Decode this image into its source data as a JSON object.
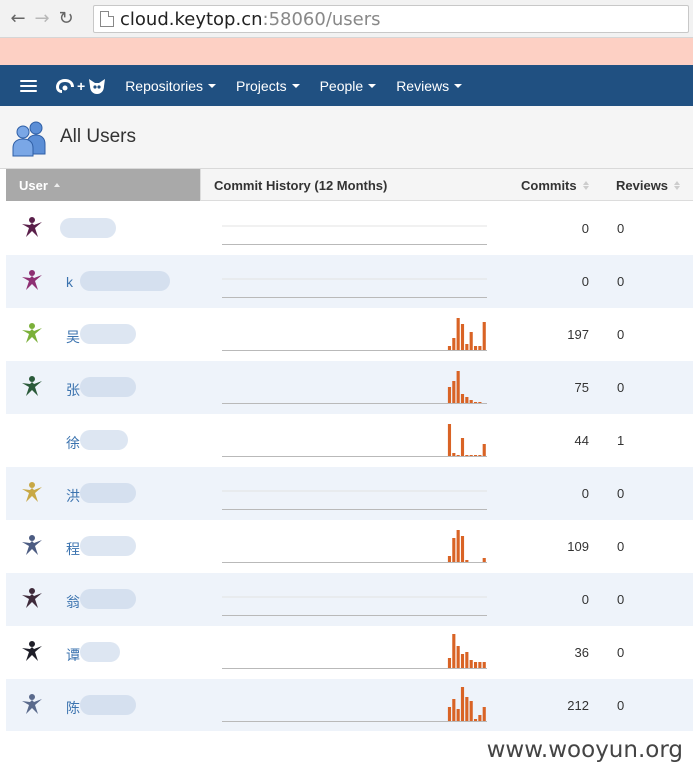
{
  "browser": {
    "back_icon": "←",
    "forward_icon": "→",
    "reload_icon": "↻",
    "url_host": "cloud.keytop.cn",
    "url_rest": ":58060/users"
  },
  "nav": {
    "menu": [
      {
        "label": "Repositories"
      },
      {
        "label": "Projects"
      },
      {
        "label": "People"
      },
      {
        "label": "Reviews"
      }
    ]
  },
  "header": {
    "title": "All Users"
  },
  "table": {
    "columns": {
      "user": "User",
      "history": "Commit History (12 Months)",
      "commits": "Commits",
      "reviews": "Reviews"
    },
    "rows": [
      {
        "name": "",
        "commits": "0",
        "reviews": "0",
        "avatar_color": "#5a1f4a",
        "history": [
          0,
          0,
          0,
          0,
          0,
          0,
          0,
          0,
          0,
          0,
          0,
          0
        ]
      },
      {
        "name": "k",
        "commits": "0",
        "reviews": "0",
        "avatar_color": "#8e2f73",
        "history": [
          0,
          0,
          0,
          0,
          0,
          0,
          0,
          0,
          0,
          0,
          0,
          0
        ]
      },
      {
        "name": "吴",
        "commits": "197",
        "reviews": "0",
        "avatar_color": "#7bb03a",
        "history": [
          0,
          0,
          0,
          0,
          0,
          0,
          0,
          0,
          0,
          0,
          0,
          0,
          0,
          0,
          0,
          0,
          0,
          0,
          0,
          0,
          0,
          0,
          0,
          0,
          0,
          0,
          0,
          0,
          0,
          0,
          0,
          0,
          0,
          0,
          0,
          0,
          0,
          0,
          0,
          0,
          0,
          0,
          0,
          0,
          0,
          0,
          0,
          0,
          0,
          0,
          0,
          0,
          4,
          12,
          32,
          26,
          6,
          18,
          4,
          4,
          28
        ]
      },
      {
        "name": "张",
        "commits": "75",
        "reviews": "0",
        "avatar_color": "#2b5a3a",
        "history": [
          0,
          0,
          0,
          0,
          0,
          0,
          0,
          0,
          0,
          0,
          0,
          0,
          0,
          0,
          0,
          0,
          0,
          0,
          0,
          0,
          0,
          0,
          0,
          0,
          0,
          0,
          0,
          0,
          0,
          0,
          0,
          0,
          0,
          0,
          0,
          0,
          0,
          0,
          0,
          0,
          0,
          0,
          0,
          0,
          0,
          0,
          0,
          0,
          0,
          0,
          0,
          0,
          16,
          22,
          32,
          9,
          6,
          3,
          1,
          1,
          0
        ]
      },
      {
        "name": "徐",
        "commits": "44",
        "reviews": "1",
        "avatar_color": "#ffffff",
        "history": [
          0,
          0,
          0,
          0,
          0,
          0,
          0,
          0,
          0,
          0,
          0,
          0,
          0,
          0,
          0,
          0,
          0,
          0,
          0,
          0,
          0,
          0,
          0,
          0,
          0,
          0,
          0,
          0,
          0,
          0,
          0,
          0,
          0,
          0,
          0,
          0,
          0,
          0,
          0,
          0,
          0,
          0,
          0,
          0,
          0,
          0,
          0,
          0,
          0,
          0,
          0,
          0,
          32,
          3,
          1,
          18,
          1,
          1,
          1,
          1,
          12
        ]
      },
      {
        "name": "洪",
        "commits": "0",
        "reviews": "0",
        "avatar_color": "#c8a845",
        "history": [
          0,
          0,
          0,
          0,
          0,
          0,
          0,
          0,
          0,
          0,
          0,
          0
        ]
      },
      {
        "name": "程",
        "commits": "109",
        "reviews": "0",
        "avatar_color": "#4c5c82",
        "history": [
          0,
          0,
          0,
          0,
          0,
          0,
          0,
          0,
          0,
          0,
          0,
          0,
          0,
          0,
          0,
          0,
          0,
          0,
          0,
          0,
          0,
          0,
          0,
          0,
          0,
          0,
          0,
          0,
          0,
          0,
          0,
          0,
          0,
          0,
          0,
          0,
          0,
          0,
          0,
          0,
          0,
          0,
          0,
          0,
          0,
          0,
          0,
          0,
          0,
          0,
          0,
          0,
          6,
          24,
          32,
          26,
          2,
          0,
          0,
          0,
          4
        ]
      },
      {
        "name": "翁",
        "commits": "0",
        "reviews": "0",
        "avatar_color": "#3e2a3a",
        "history": [
          0,
          0,
          0,
          0,
          0,
          0,
          0,
          0,
          0,
          0,
          0,
          0
        ]
      },
      {
        "name": "谭",
        "commits": "36",
        "reviews": "0",
        "avatar_color": "#1e1e28",
        "history": [
          0,
          0,
          0,
          0,
          0,
          0,
          0,
          0,
          0,
          0,
          0,
          0,
          0,
          0,
          0,
          0,
          0,
          0,
          0,
          0,
          0,
          0,
          0,
          0,
          0,
          0,
          0,
          0,
          0,
          0,
          0,
          0,
          0,
          0,
          0,
          0,
          0,
          0,
          0,
          0,
          0,
          0,
          0,
          0,
          0,
          0,
          0,
          0,
          0,
          0,
          0,
          0,
          10,
          34,
          22,
          14,
          16,
          8,
          6,
          6,
          6
        ]
      },
      {
        "name": "陈",
        "commits": "212",
        "reviews": "0",
        "avatar_color": "#5a6a8c",
        "history": [
          0,
          0,
          0,
          0,
          0,
          0,
          0,
          0,
          0,
          0,
          0,
          0,
          0,
          0,
          0,
          0,
          0,
          0,
          0,
          0,
          0,
          0,
          0,
          0,
          0,
          0,
          0,
          0,
          0,
          0,
          0,
          0,
          0,
          0,
          0,
          0,
          0,
          0,
          0,
          0,
          0,
          0,
          0,
          0,
          0,
          0,
          0,
          0,
          0,
          0,
          0,
          0,
          14,
          22,
          12,
          34,
          24,
          20,
          2,
          6,
          14
        ]
      }
    ]
  },
  "colors": {
    "nav_bg": "#205081",
    "notice_bg": "#fdd0c4",
    "bar": "#d96325",
    "link": "#3b73af"
  },
  "watermark": "www.wooyun.org"
}
